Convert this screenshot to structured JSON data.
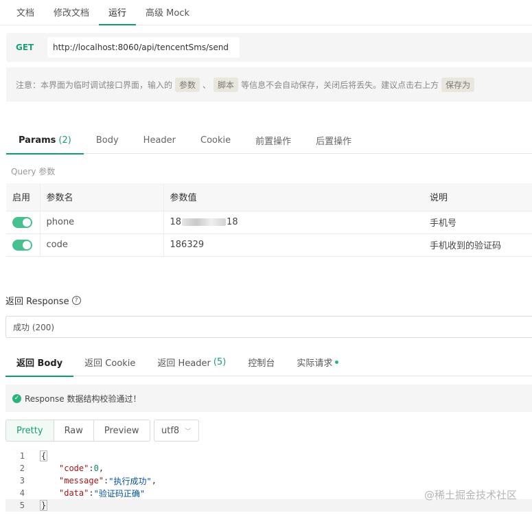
{
  "top_tabs": [
    "文档",
    "修改文档",
    "运行",
    "高级 Mock"
  ],
  "request": {
    "method": "GET",
    "url": "http://localhost:8060/api/tencentSms/send"
  },
  "notice": {
    "part1": "注意：本界面为临时调试接口界面，输入的",
    "chip1": "参数",
    "sep": "、",
    "chip2": "脚本",
    "part2": "等信息不会自动保存，关闭后将丢失。建议点击右上方",
    "chip3": "保存为"
  },
  "param_tabs": {
    "params_label": "Params",
    "params_count": "(2)",
    "body": "Body",
    "header": "Header",
    "cookie": "Cookie",
    "pre": "前置操作",
    "post": "后置操作"
  },
  "query_label": "Query 参数",
  "params_table": {
    "headers": [
      "启用",
      "参数名",
      "参数值",
      "说明"
    ],
    "rows": [
      {
        "name": "phone",
        "value_prefix": "18",
        "value_suffix": "18",
        "desc": "手机号"
      },
      {
        "name": "code",
        "value": "186329",
        "desc": "手机收到的验证码"
      }
    ]
  },
  "response": {
    "label": "返回 Response",
    "status": "成功 (200)",
    "tabs": {
      "body": "返回 Body",
      "cookie": "返回 Cookie",
      "header_label": "返回 Header",
      "header_count": "(5)",
      "console": "控制台",
      "actual": "实际请求"
    },
    "validate_msg": "Response 数据结构校验通过！",
    "views": [
      "Pretty",
      "Raw",
      "Preview"
    ],
    "encoding": "utf8",
    "code": {
      "line_numbers": [
        "1",
        "2",
        "3",
        "4",
        "5"
      ],
      "open": "{",
      "close": "}",
      "k1": "\"code\"",
      "v1": "0",
      "k2": "\"message\"",
      "v2": "\"执行成功\"",
      "k3": "\"data\"",
      "v3": "\"验证码正确\""
    }
  },
  "watermark": "@稀土掘金技术社区",
  "colors": {
    "accent": "#0c9e6d",
    "toggle": "#46c08f",
    "method": "#19a06e"
  }
}
